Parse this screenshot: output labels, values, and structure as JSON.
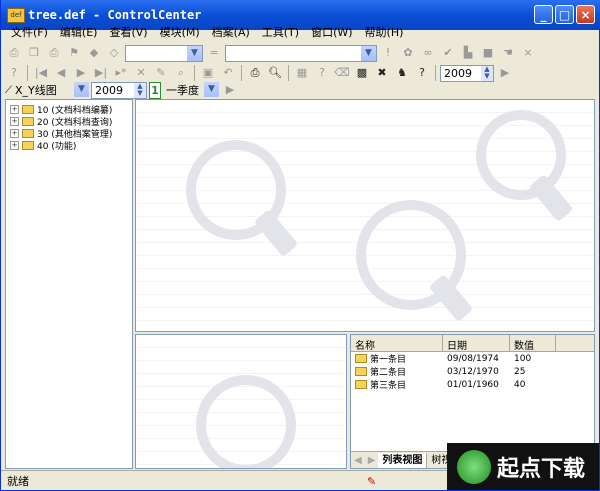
{
  "window": {
    "title": "tree.def - ControlCenter",
    "icon_text": "def"
  },
  "menubar": [
    "文件(F)",
    "编辑(E)",
    "查看(V)",
    "模块(M)",
    "档案(A)",
    "工具(T)",
    "窗口(W)",
    "帮助(H)"
  ],
  "toolbar2": {
    "year": "2009"
  },
  "toolbar3": {
    "chart_type": "X_Y线图",
    "year": "2009",
    "period_num": "1",
    "period": "一季度"
  },
  "tree": [
    "10 (文档科档编纂)",
    "20 (文档科档查询)",
    "30 (其他档案管理)",
    "40 (功能)"
  ],
  "list": {
    "columns": [
      "名称",
      "日期",
      "数值"
    ],
    "rows": [
      [
        "第一条目",
        "09/08/1974",
        "100"
      ],
      [
        "第二条目",
        "03/12/1970",
        "25"
      ],
      [
        "第三条目",
        "01/01/1960",
        "40"
      ]
    ],
    "tabs": [
      "列表视图",
      "树视图"
    ]
  },
  "status": {
    "text": "就绪"
  },
  "watermark": {
    "text": "起点下载"
  }
}
